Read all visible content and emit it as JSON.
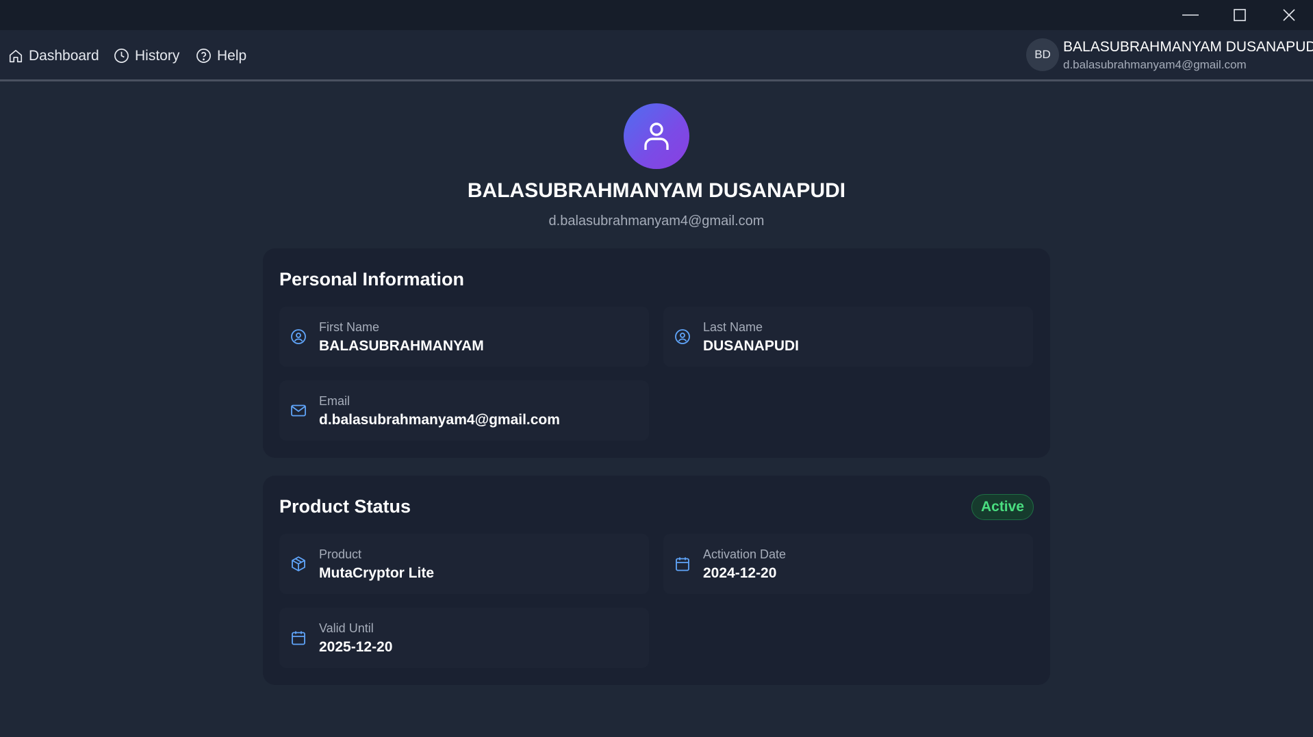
{
  "window": {
    "controls": [
      "minimize",
      "maximize",
      "close"
    ]
  },
  "nav": {
    "items": [
      {
        "label": "Dashboard",
        "icon": "home-icon"
      },
      {
        "label": "History",
        "icon": "clock-icon"
      },
      {
        "label": "Help",
        "icon": "help-circle-icon"
      }
    ]
  },
  "user": {
    "initials": "BD",
    "name": "BALASUBRAHMANYAM DUSANAPUDI",
    "email": "d.balasubrahmanyam4@gmail.com"
  },
  "profile": {
    "avatar_icon": "user-icon",
    "name": "BALASUBRAHMANYAM DUSANAPUDI",
    "email": "d.balasubrahmanyam4@gmail.com"
  },
  "personal": {
    "title": "Personal Information",
    "first_name": {
      "label": "First Name",
      "value": "BALASUBRAHMANYAM",
      "icon": "user-circle-icon"
    },
    "last_name": {
      "label": "Last Name",
      "value": "DUSANAPUDI",
      "icon": "user-circle-icon"
    },
    "email": {
      "label": "Email",
      "value": "d.balasubrahmanyam4@gmail.com",
      "icon": "mail-icon"
    }
  },
  "product": {
    "title": "Product Status",
    "status": "Active",
    "name": {
      "label": "Product",
      "value": "MutaCryptor Lite",
      "icon": "package-icon"
    },
    "activation": {
      "label": "Activation Date",
      "value": "2024-12-20",
      "icon": "calendar-icon"
    },
    "valid_until": {
      "label": "Valid Until",
      "value": "2025-12-20",
      "icon": "calendar-icon"
    }
  },
  "colors": {
    "background": "#1f2837",
    "card": "#1a2131",
    "accent_icon": "#60a5fa",
    "status_active": "#4ade80",
    "avatar_gradient_start": "#4f6ef0",
    "avatar_gradient_end": "#8a3fe0"
  }
}
